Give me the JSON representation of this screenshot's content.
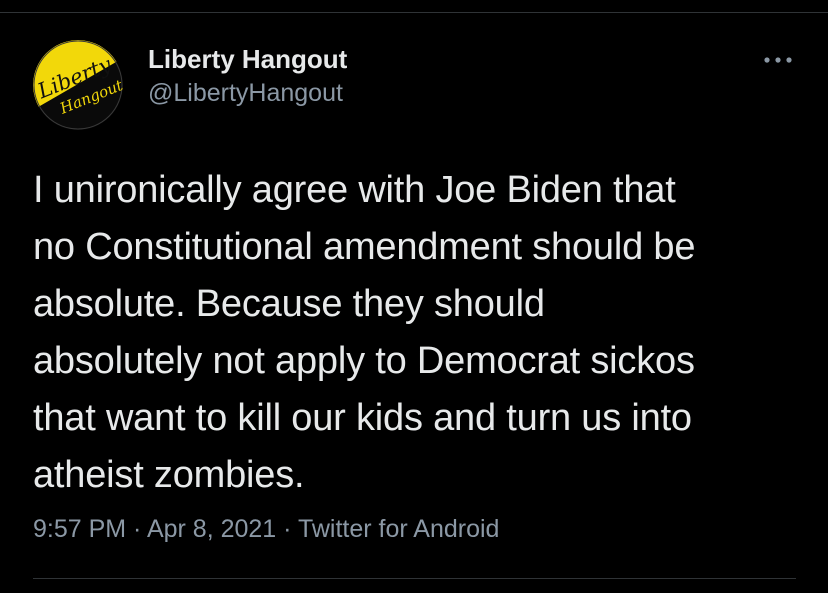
{
  "tweet": {
    "author": {
      "display_name": "Liberty Hangout",
      "handle": "@LibertyHangout",
      "avatar_text_top": "Liberty",
      "avatar_text_bottom": "Hangout",
      "avatar_icon": "liberty-hangout-logo"
    },
    "more_icon": "more-horizontal-icon",
    "text": "I unironically agree with Joe Biden that\nno Constitutional amendment should be\nabsolute. Because they should\nabsolutely not apply to Democrat sickos\nthat want to kill our kids and turn us into\natheist zombies.",
    "time": "9:57 PM",
    "sep1": " · ",
    "date": "Apr 8, 2021",
    "sep2": " · ",
    "source": "Twitter for Android"
  },
  "colors": {
    "background": "#000000",
    "text_primary": "#e7e9ea",
    "text_secondary": "#8b98a5",
    "divider": "#2f3336",
    "logo_yellow": "#f2d80a"
  }
}
